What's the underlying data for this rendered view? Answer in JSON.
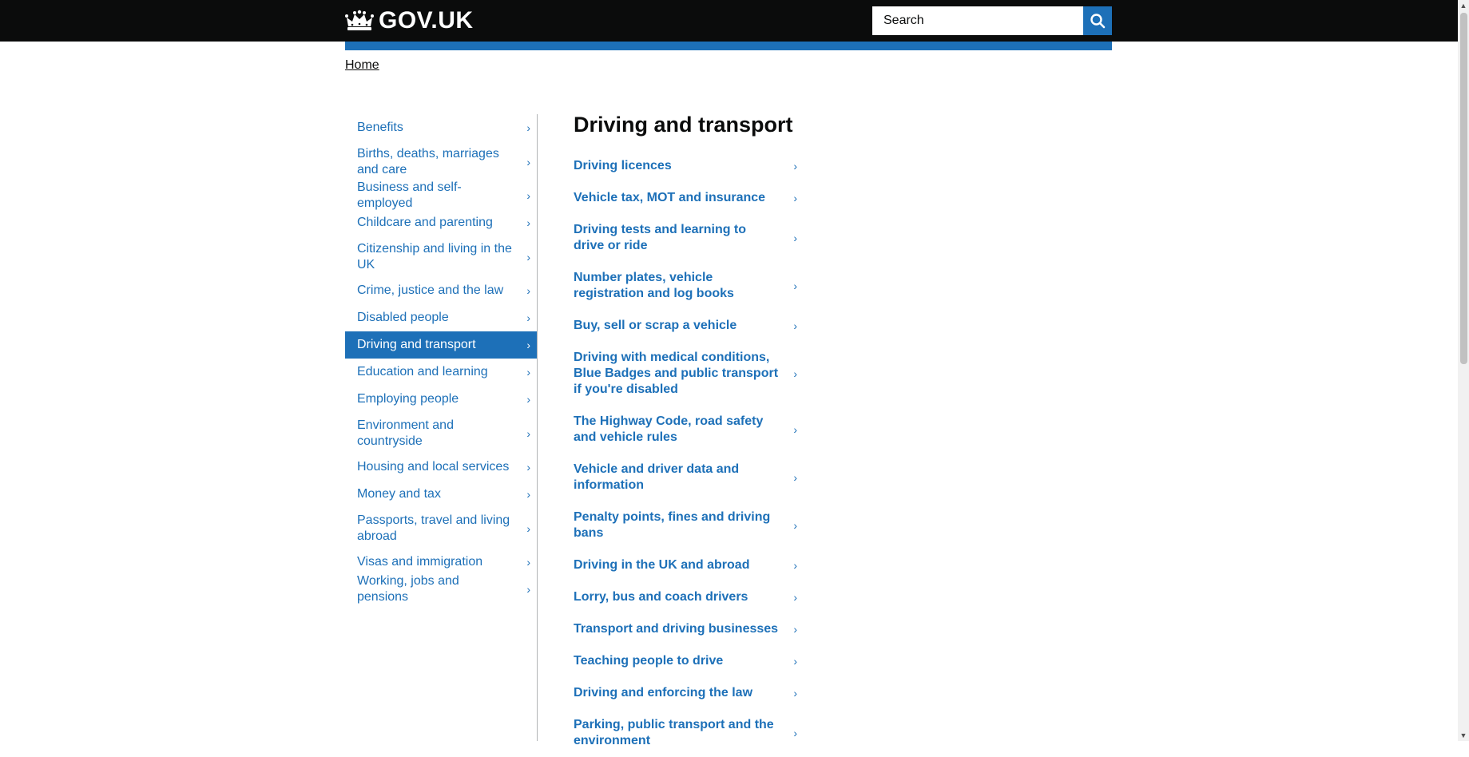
{
  "header": {
    "logo_text": "GOV.UK",
    "search_placeholder": "Search",
    "search_button_label": "Search"
  },
  "breadcrumb": {
    "home": "Home"
  },
  "sidebar": {
    "items": [
      {
        "label": "Benefits",
        "active": false
      },
      {
        "label": "Births, deaths, marriages and care",
        "active": false
      },
      {
        "label": "Business and self-employed",
        "active": false
      },
      {
        "label": "Childcare and parenting",
        "active": false
      },
      {
        "label": "Citizenship and living in the UK",
        "active": false
      },
      {
        "label": "Crime, justice and the law",
        "active": false
      },
      {
        "label": "Disabled people",
        "active": false
      },
      {
        "label": "Driving and transport",
        "active": true
      },
      {
        "label": "Education and learning",
        "active": false
      },
      {
        "label": "Employing people",
        "active": false
      },
      {
        "label": "Environment and countryside",
        "active": false
      },
      {
        "label": "Housing and local services",
        "active": false
      },
      {
        "label": "Money and tax",
        "active": false
      },
      {
        "label": "Passports, travel and living abroad",
        "active": false
      },
      {
        "label": "Visas and immigration",
        "active": false
      },
      {
        "label": "Working, jobs and pensions",
        "active": false
      }
    ]
  },
  "main": {
    "title": "Driving and transport",
    "topics": [
      "Driving licences",
      "Vehicle tax, MOT and insurance",
      "Driving tests and learning to drive or ride",
      "Number plates, vehicle registration and log books",
      "Buy, sell or scrap a vehicle",
      "Driving with medical conditions, Blue Badges and public transport if you're disabled",
      "The Highway Code, road safety and vehicle rules",
      "Vehicle and driver data and information",
      "Penalty points, fines and driving bans",
      "Driving in the UK and abroad",
      "Lorry, bus and coach drivers",
      "Transport and driving businesses",
      "Teaching people to drive",
      "Driving and enforcing the law",
      "Parking, public transport and the environment"
    ]
  },
  "colors": {
    "header_bg": "#0b0c0c",
    "link_blue": "#1d70b8",
    "active_bg": "#1d70b8"
  },
  "icons": {
    "crown": "crown-icon",
    "search": "search-icon",
    "chevron": "chevron-right-icon"
  }
}
